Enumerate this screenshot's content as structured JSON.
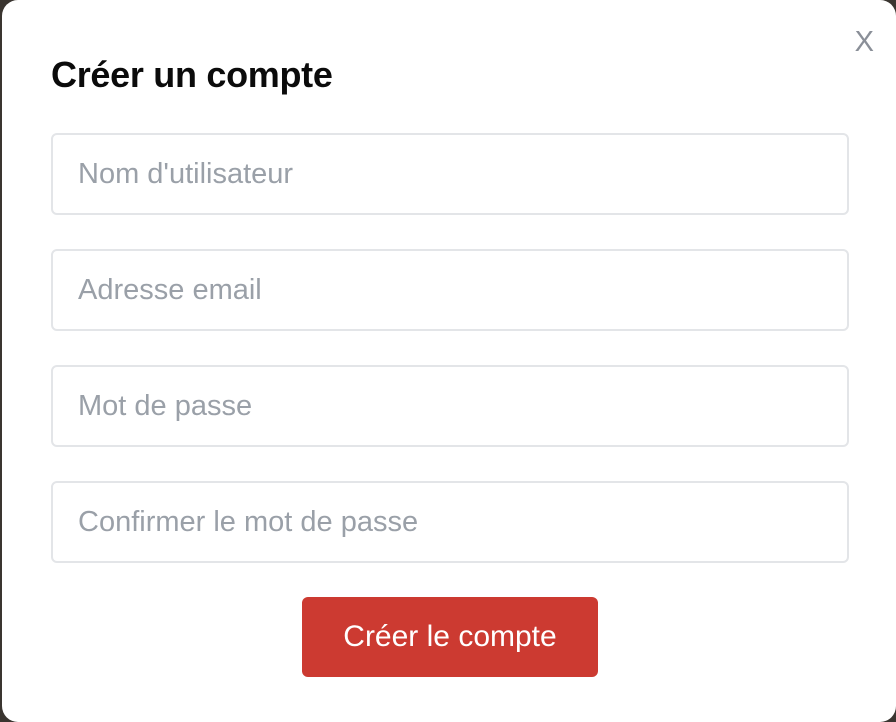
{
  "modal": {
    "title": "Créer un compte",
    "close_label": "X",
    "fields": [
      {
        "placeholder": "Nom d'utilisateur",
        "value": ""
      },
      {
        "placeholder": "Adresse email",
        "value": ""
      },
      {
        "placeholder": "Mot de passe",
        "value": ""
      },
      {
        "placeholder": "Confirmer le mot de passe",
        "value": ""
      }
    ],
    "submit_label": "Créer le compte"
  },
  "colors": {
    "accent": "#cc3a31",
    "title": "#0b0b0b",
    "placeholder": "#9aa0a8",
    "border": "#e3e5e8",
    "close": "#8a8f98"
  }
}
